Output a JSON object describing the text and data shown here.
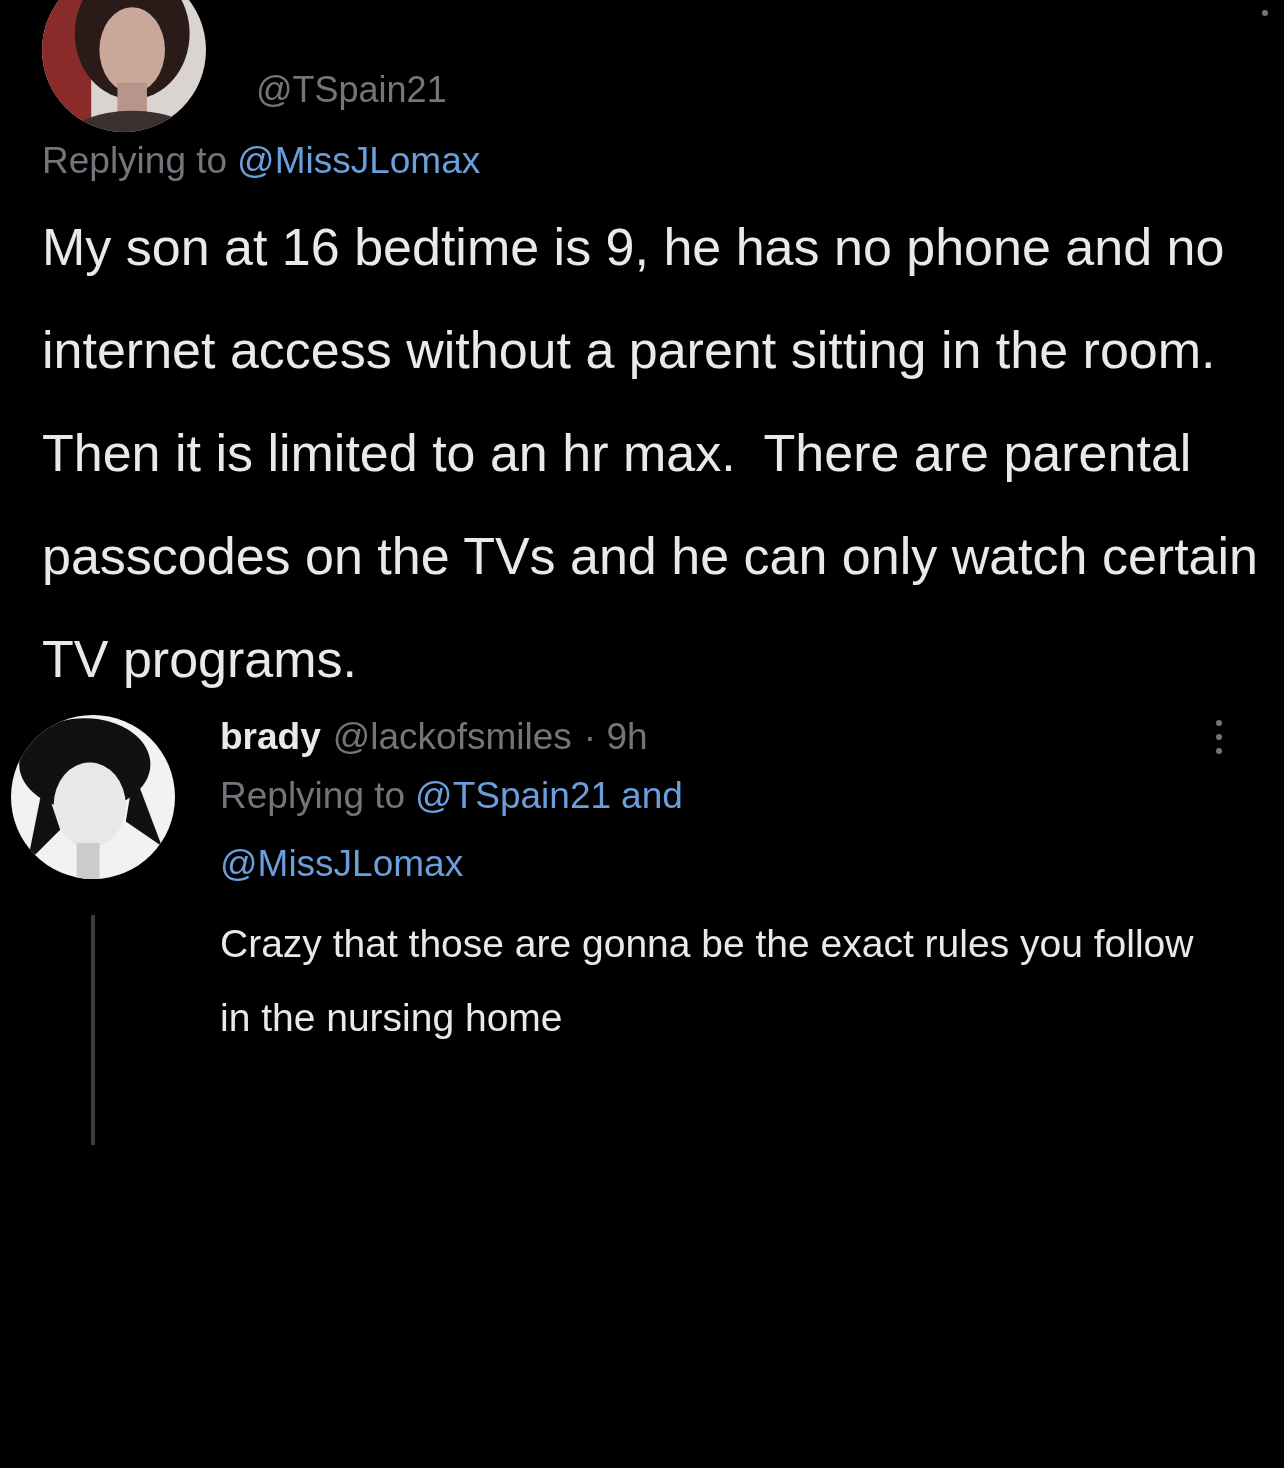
{
  "tweet": {
    "handle": "@TSpain21",
    "replying_prefix": "Replying to",
    "replying_to": [
      "@MissJLomax"
    ],
    "text": "My son at 16 bedtime is 9, he has no phone and no internet access without a parent sitting in the room. Then it is limited to an hr max.  There are parental passcodes on the TVs and he can only watch certain TV programs."
  },
  "reply": {
    "name": "brady",
    "handle": "@lackofsmiles",
    "time": "· 9h",
    "replying_prefix": "Replying to",
    "replying_to": [
      "@TSpain21",
      "and",
      "@MissJLomax"
    ],
    "text": "Crazy that those are gonna be the exact rules you follow in the nursing home"
  }
}
